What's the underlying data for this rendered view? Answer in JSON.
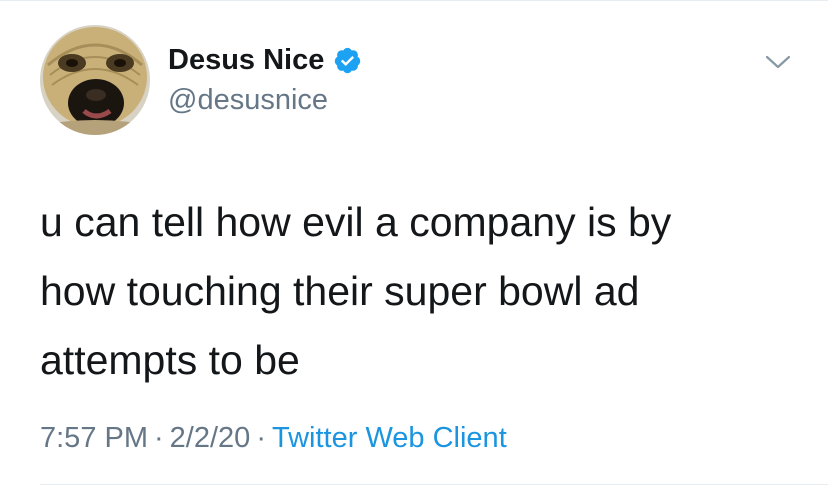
{
  "author": {
    "display_name": "Desus Nice",
    "handle": "@desusnice",
    "verified": true,
    "avatar_icon": "masked-face-avatar"
  },
  "tweet": {
    "lines": [
      "u can tell how evil a company is by",
      "how touching their super bowl ad",
      "attempts to be"
    ]
  },
  "meta": {
    "time": "7:57 PM",
    "separator": "·",
    "date": "2/2/20",
    "client": "Twitter Web Client"
  },
  "icons": {
    "verified": "verified-badge-icon",
    "menu": "chevron-down-icon"
  },
  "colors": {
    "text": "#14171a",
    "secondary": "#657786",
    "link": "#1b95e0",
    "verified": "#1da1f2",
    "divider": "#e6ecf0"
  }
}
